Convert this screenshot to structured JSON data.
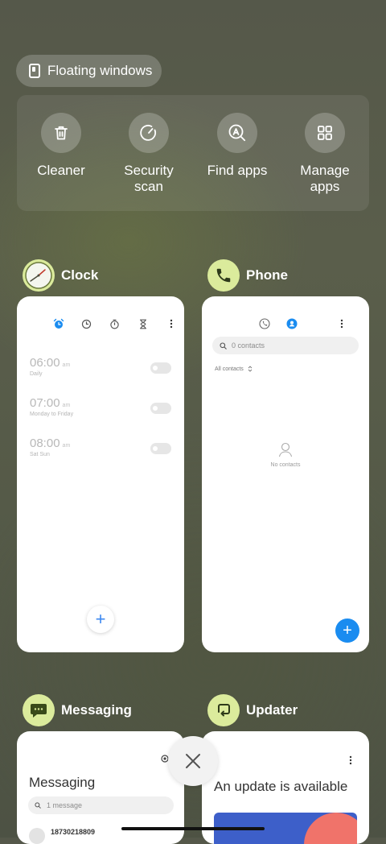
{
  "floating": {
    "label": "Floating windows"
  },
  "tools": [
    {
      "label": "Cleaner",
      "icon": "trash-icon"
    },
    {
      "label": "Security\nscan",
      "icon": "speedometer-icon"
    },
    {
      "label": "Find apps",
      "icon": "search-apps-icon"
    },
    {
      "label": "Manage\napps",
      "icon": "grid-icon"
    }
  ],
  "apps": {
    "clock": {
      "name": "Clock",
      "alarms": [
        {
          "time": "06:00",
          "ampm": "am",
          "repeat": "Daily"
        },
        {
          "time": "07:00",
          "ampm": "am",
          "repeat": "Monday to Friday"
        },
        {
          "time": "08:00",
          "ampm": "am",
          "repeat": "Sat Sun"
        }
      ],
      "add_label": "+"
    },
    "phone": {
      "name": "Phone",
      "search_placeholder": "0 contacts",
      "filter_label": "All contacts",
      "empty_label": "No contacts",
      "add_label": "+"
    },
    "messaging": {
      "name": "Messaging",
      "title": "Messaging",
      "search_placeholder": "1 message",
      "first_sender": "18730218809"
    },
    "updater": {
      "name": "Updater",
      "headline": "An update is available"
    }
  },
  "colors": {
    "icon_bg": "#dbeb9c",
    "accent_blue": "#1a8cf0"
  }
}
